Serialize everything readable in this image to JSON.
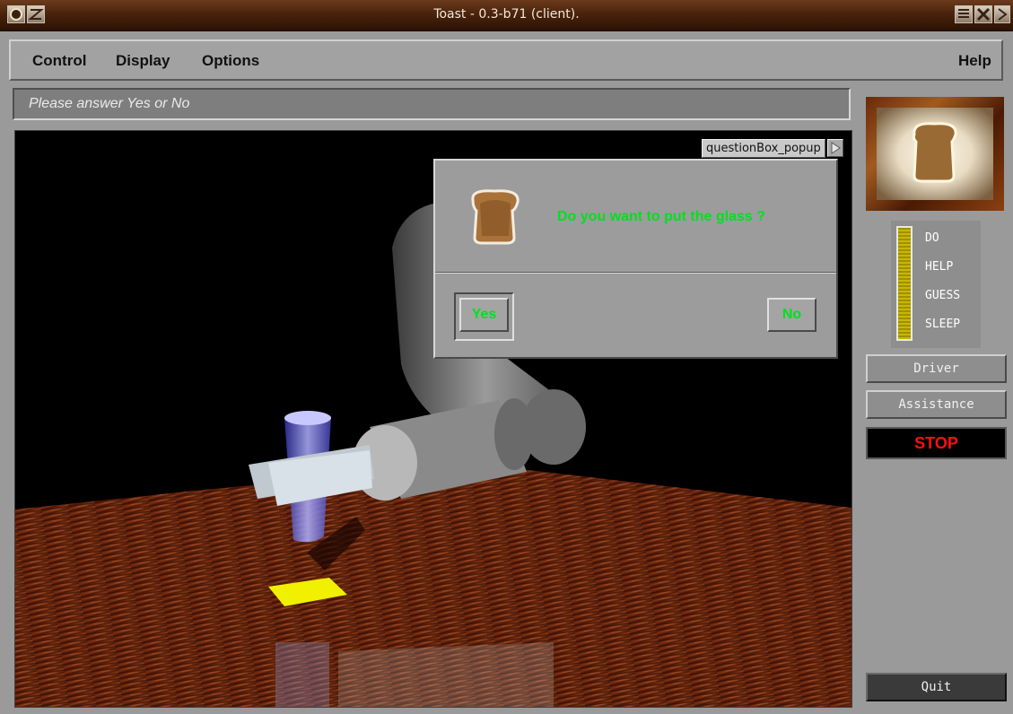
{
  "window": {
    "title": "Toast - 0.3-b71 (client).",
    "controls": [
      "menu-icon",
      "close-icon",
      "shade-icon"
    ],
    "colors": {
      "titlebar": "#4a230c",
      "title_text": "#f2e8d8"
    }
  },
  "menubar": {
    "items": [
      "Control",
      "Display",
      "Options"
    ],
    "help": "Help"
  },
  "prompt": {
    "text": "Please answer Yes or No"
  },
  "popup": {
    "tab_label": "questionBox_popup",
    "icon": "toast-icon",
    "question": "Do you want to put the glass ?",
    "yes_label": "Yes",
    "no_label": "No",
    "text_color": "#00e020"
  },
  "side_panel": {
    "portrait_icon": "toast-icon",
    "modes": [
      "DO",
      "HELP",
      "GUESS",
      "SLEEP"
    ],
    "driver_label": "Driver",
    "assistance_label": "Assistance",
    "stop_label": "STOP",
    "quit_label": "Quit",
    "stop_color": "#ff1010"
  },
  "scene": {
    "description_icon": "robot-arm-3d-scene"
  }
}
